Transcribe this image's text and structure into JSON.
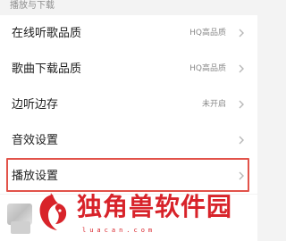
{
  "section": {
    "title": "播放与下载"
  },
  "rows": [
    {
      "label": "在线听歌品质",
      "value": "HQ高品质"
    },
    {
      "label": "歌曲下载品质",
      "value": "HQ高品质"
    },
    {
      "label": "边听边存",
      "value": "未开启"
    },
    {
      "label": "音效设置",
      "value": ""
    },
    {
      "label": "播放设置",
      "value": ""
    }
  ],
  "watermark": {
    "text": "独角兽软件园",
    "url": "luacan.com"
  },
  "colors": {
    "highlight": "#e2534a",
    "watermark": "#d8232a"
  }
}
